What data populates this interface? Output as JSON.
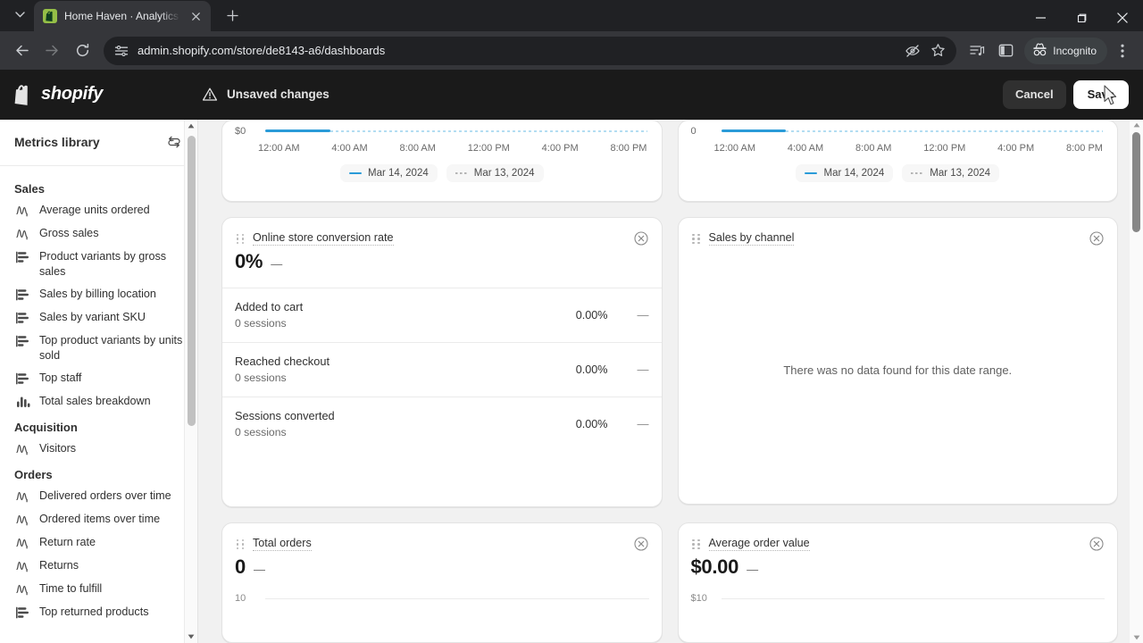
{
  "browser": {
    "tab": {
      "title": "Home Haven · Analytics · Shopi",
      "favicon": "shopify-bag-icon"
    },
    "new_tab_label": "+",
    "url": "admin.shopify.com/store/de8143-a6/dashboards",
    "profile_chip": "Incognito",
    "icons": {
      "tab_search": "chevron-down-icon",
      "tab_close": "close-icon",
      "back": "back-arrow-icon",
      "forward": "forward-arrow-icon",
      "reload": "reload-icon",
      "site_info": "site-settings-icon",
      "tracking_protection": "eye-off-icon",
      "bookmark": "star-icon",
      "reading_list": "reading-list-icon",
      "side_panel": "side-panel-icon",
      "menu": "three-dot-menu-icon",
      "minimize": "minimize-icon",
      "maximize": "maximize-icon",
      "close_window": "window-close-icon"
    }
  },
  "header": {
    "brand": "shopify",
    "unsaved_text": "Unsaved changes",
    "cancel_label": "Cancel",
    "save_label": "Save"
  },
  "sidebar": {
    "title": "Metrics library",
    "sync_icon": "sync-swap-icon",
    "groups": [
      {
        "name": "Sales",
        "items": [
          {
            "label": "Average units ordered",
            "icon": "line-chart-icon"
          },
          {
            "label": "Gross sales",
            "icon": "line-chart-icon"
          },
          {
            "label": "Product variants by gross sales",
            "icon": "bar-chart-horizontal-icon"
          },
          {
            "label": "Sales by billing location",
            "icon": "bar-chart-horizontal-icon"
          },
          {
            "label": "Sales by variant SKU",
            "icon": "bar-chart-horizontal-icon"
          },
          {
            "label": "Top product variants by units sold",
            "icon": "bar-chart-horizontal-icon"
          },
          {
            "label": "Top staff",
            "icon": "bar-chart-horizontal-icon"
          },
          {
            "label": "Total sales breakdown",
            "icon": "bar-chart-vertical-icon"
          }
        ]
      },
      {
        "name": "Acquisition",
        "items": [
          {
            "label": "Visitors",
            "icon": "line-chart-icon"
          }
        ]
      },
      {
        "name": "Orders",
        "items": [
          {
            "label": "Delivered orders over time",
            "icon": "line-chart-icon"
          },
          {
            "label": "Ordered items over time",
            "icon": "line-chart-icon"
          },
          {
            "label": "Return rate",
            "icon": "line-chart-icon"
          },
          {
            "label": "Returns",
            "icon": "line-chart-icon"
          },
          {
            "label": "Time to fulfill",
            "icon": "line-chart-icon"
          },
          {
            "label": "Top returned products",
            "icon": "bar-chart-horizontal-icon"
          }
        ]
      }
    ]
  },
  "dashboard": {
    "top_left_chart": {
      "axis_zero": "$0",
      "ticks": [
        "12:00 AM",
        "4:00 AM",
        "8:00 AM",
        "12:00 PM",
        "4:00 PM",
        "8:00 PM"
      ],
      "legend": [
        "Mar 14, 2024",
        "Mar 13, 2024"
      ]
    },
    "top_right_chart": {
      "axis_zero": "0",
      "ticks": [
        "12:00 AM",
        "4:00 AM",
        "8:00 AM",
        "12:00 PM",
        "4:00 PM",
        "8:00 PM"
      ],
      "legend": [
        "Mar 14, 2024",
        "Mar 13, 2024"
      ]
    },
    "conversion_card": {
      "title": "Online store conversion rate",
      "value": "0%",
      "delta": "—",
      "rows": [
        {
          "name": "Added to cart",
          "sub": "0 sessions",
          "pct": "0.00%",
          "delta": "—"
        },
        {
          "name": "Reached checkout",
          "sub": "0 sessions",
          "pct": "0.00%",
          "delta": "—"
        },
        {
          "name": "Sessions converted",
          "sub": "0 sessions",
          "pct": "0.00%",
          "delta": "—"
        }
      ]
    },
    "channel_card": {
      "title": "Sales by channel",
      "empty_message": "There was no data found for this date range."
    },
    "total_orders_card": {
      "title": "Total orders",
      "value": "0",
      "delta": "—",
      "y_top": "10"
    },
    "aov_card": {
      "title": "Average order value",
      "value": "$0.00",
      "delta": "—",
      "y_top": "$10"
    },
    "close_icon": "close-circle-icon",
    "drag_icon": "drag-handle-icon"
  },
  "colors": {
    "accent_line": "#2a9bd8",
    "shopify_green": "#95bf47",
    "chrome_dark": "#202124",
    "toolbar_dark": "#35363a",
    "header_dark": "#1a1a1a",
    "page_bg": "#f1f1f1"
  }
}
